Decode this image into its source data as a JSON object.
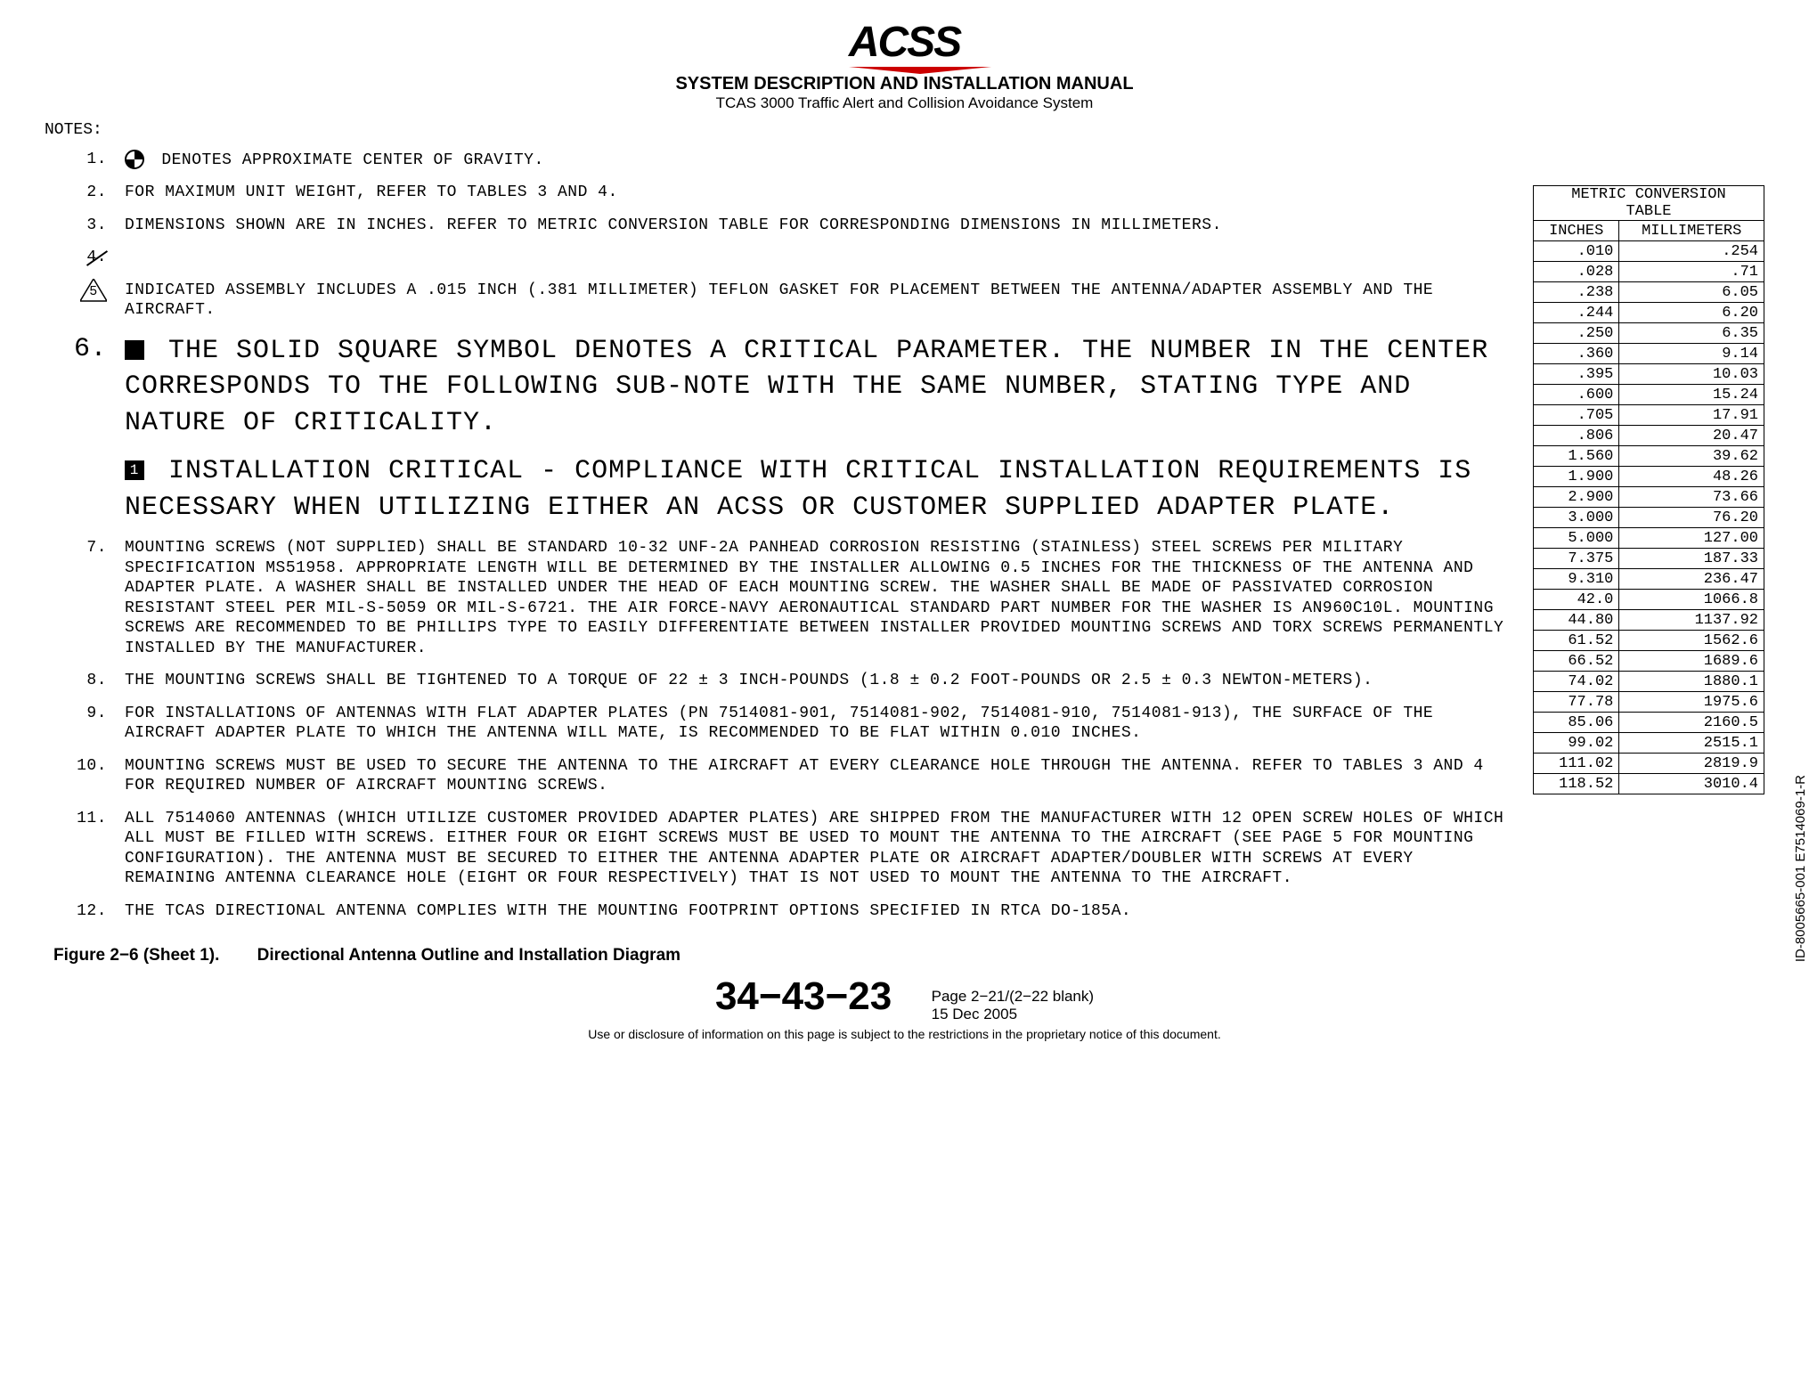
{
  "header": {
    "logo_text": "ACSS",
    "title1": "SYSTEM DESCRIPTION AND INSTALLATION MANUAL",
    "title2": "TCAS 3000 Traffic Alert and Collision Avoidance System"
  },
  "notes_heading": "NOTES:",
  "notes": {
    "n1_num": "1.",
    "n1": "DENOTES APPROXIMATE CENTER OF GRAVITY.",
    "n2_num": "2.",
    "n2": "FOR MAXIMUM UNIT WEIGHT, REFER TO TABLES 3 AND 4.",
    "n3_num": "3.",
    "n3": "DIMENSIONS SHOWN ARE IN INCHES. REFER TO METRIC CONVERSION TABLE FOR CORRESPONDING DIMENSIONS IN MILLIMETERS.",
    "n4_num": "4.",
    "n5_num": "5",
    "n5": "INDICATED ASSEMBLY INCLUDES A .015 INCH (.381 MILLIMETER) TEFLON GASKET FOR PLACEMENT BETWEEN THE ANTENNA/ADAPTER ASSEMBLY AND THE AIRCRAFT.",
    "n6_num": "6.",
    "n6a": "THE SOLID SQUARE SYMBOL DENOTES A CRITICAL PARAMETER. THE NUMBER IN THE CENTER CORRESPONDS TO THE FOLLOWING SUB-NOTE WITH THE SAME NUMBER, STATING TYPE AND NATURE OF CRITICALITY.",
    "n6b_num": "1",
    "n6b": "INSTALLATION CRITICAL - COMPLIANCE WITH CRITICAL INSTALLATION REQUIREMENTS IS NECESSARY WHEN UTILIZING EITHER AN ACSS OR CUSTOMER SUPPLIED ADAPTER PLATE.",
    "n7_num": "7.",
    "n7": "MOUNTING SCREWS (NOT SUPPLIED) SHALL BE STANDARD 10-32 UNF-2A PANHEAD CORROSION RESISTING (STAINLESS) STEEL SCREWS PER MILITARY SPECIFICATION MS51958. APPROPRIATE LENGTH WILL BE DETERMINED BY THE INSTALLER ALLOWING 0.5 INCHES FOR THE THICKNESS OF THE ANTENNA AND ADAPTER PLATE. A WASHER SHALL BE INSTALLED UNDER THE HEAD OF EACH MOUNTING SCREW. THE WASHER SHALL BE MADE OF PASSIVATED CORROSION RESISTANT STEEL PER MIL-S-5059 OR MIL-S-6721. THE AIR FORCE-NAVY AERONAUTICAL STANDARD PART NUMBER FOR THE WASHER IS AN960C10L. MOUNTING SCREWS ARE RECOMMENDED TO BE PHILLIPS TYPE TO EASILY DIFFERENTIATE BETWEEN INSTALLER PROVIDED MOUNTING SCREWS AND TORX SCREWS PERMANENTLY INSTALLED BY THE MANUFACTURER.",
    "n8_num": "8.",
    "n8": "THE MOUNTING SCREWS SHALL BE TIGHTENED TO A TORQUE OF 22 ± 3 INCH-POUNDS (1.8 ± 0.2 FOOT-POUNDS OR 2.5 ± 0.3 NEWTON-METERS).",
    "n9_num": "9.",
    "n9": "FOR INSTALLATIONS OF ANTENNAS WITH FLAT ADAPTER PLATES (PN 7514081-901, 7514081-902, 7514081-910, 7514081-913), THE SURFACE OF THE AIRCRAFT ADAPTER PLATE TO WHICH THE ANTENNA WILL MATE, IS RECOMMENDED TO BE FLAT WITHIN 0.010 INCHES.",
    "n10_num": "10.",
    "n10": "MOUNTING SCREWS MUST BE USED TO SECURE THE ANTENNA TO THE AIRCRAFT AT EVERY CLEARANCE HOLE THROUGH THE ANTENNA. REFER TO TABLES 3 AND 4 FOR REQUIRED NUMBER OF AIRCRAFT MOUNTING SCREWS.",
    "n11_num": "11.",
    "n11": "ALL 7514060 ANTENNAS (WHICH UTILIZE CUSTOMER PROVIDED ADAPTER PLATES) ARE SHIPPED FROM THE MANUFACTURER WITH 12 OPEN SCREW HOLES OF WHICH ALL MUST BE FILLED WITH SCREWS. EITHER FOUR OR EIGHT SCREWS MUST BE USED TO MOUNT THE ANTENNA TO THE AIRCRAFT (SEE PAGE 5 FOR MOUNTING CONFIGURATION). THE ANTENNA MUST BE SECURED TO EITHER  THE ANTENNA ADAPTER PLATE  OR AIRCRAFT ADAPTER/DOUBLER WITH SCREWS AT EVERY REMAINING ANTENNA CLEARANCE HOLE (EIGHT OR FOUR RESPECTIVELY) THAT IS NOT USED TO MOUNT THE ANTENNA TO THE AIRCRAFT.",
    "n12_num": "12.",
    "n12": "THE TCAS DIRECTIONAL ANTENNA COMPLIES WITH THE MOUNTING FOOTPRINT OPTIONS SPECIFIED IN RTCA DO-185A."
  },
  "table": {
    "title1": "METRIC CONVERSION",
    "title2": "TABLE",
    "h1": "INCHES",
    "h2": "MILLIMETERS",
    "rows": [
      {
        "in": ".010",
        "mm": ".254"
      },
      {
        "in": ".028",
        "mm": ".71"
      },
      {
        "in": ".238",
        "mm": "6.05"
      },
      {
        "in": ".244",
        "mm": "6.20"
      },
      {
        "in": ".250",
        "mm": "6.35"
      },
      {
        "in": ".360",
        "mm": "9.14"
      },
      {
        "in": ".395",
        "mm": "10.03"
      },
      {
        "in": ".600",
        "mm": "15.24"
      },
      {
        "in": ".705",
        "mm": "17.91"
      },
      {
        "in": ".806",
        "mm": "20.47"
      },
      {
        "in": "1.560",
        "mm": "39.62"
      },
      {
        "in": "1.900",
        "mm": "48.26"
      },
      {
        "in": "2.900",
        "mm": "73.66"
      },
      {
        "in": "3.000",
        "mm": "76.20"
      },
      {
        "in": "5.000",
        "mm": "127.00"
      },
      {
        "in": "7.375",
        "mm": "187.33"
      },
      {
        "in": "9.310",
        "mm": "236.47"
      },
      {
        "in": "42.0",
        "mm": "1066.8"
      },
      {
        "in": "44.80",
        "mm": "1137.92"
      },
      {
        "in": "61.52",
        "mm": "1562.6"
      },
      {
        "in": "66.52",
        "mm": "1689.6"
      },
      {
        "in": "74.02",
        "mm": "1880.1"
      },
      {
        "in": "77.78",
        "mm": "1975.6"
      },
      {
        "in": "85.06",
        "mm": "2160.5"
      },
      {
        "in": "99.02",
        "mm": "2515.1"
      },
      {
        "in": "111.02",
        "mm": "2819.9"
      },
      {
        "in": "118.52",
        "mm": "3010.4"
      }
    ]
  },
  "side_code": "ID-8005665-001  E7514069-1-R",
  "figure": {
    "label": "Figure 2−6 (Sheet 1).",
    "title": "Directional Antenna Outline and Installation Diagram"
  },
  "footer": {
    "ata": "34−43−23",
    "page": "Page 2−21/(2−22 blank)",
    "date": "15 Dec 2005",
    "disclaimer": "Use or disclosure of information on this page is subject to the restrictions in the proprietary notice of this document."
  }
}
